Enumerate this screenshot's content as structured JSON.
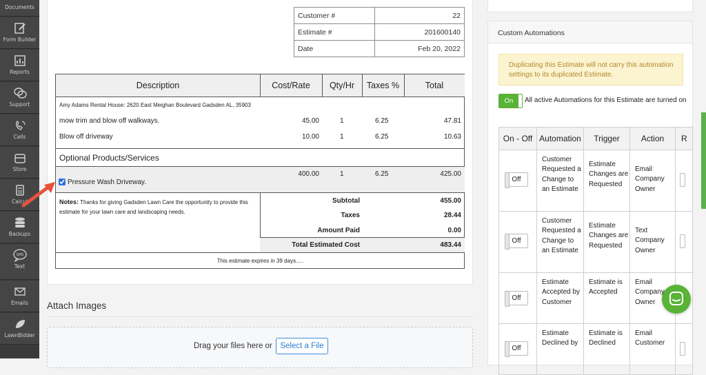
{
  "sidebar": {
    "items": [
      {
        "label": "Documents",
        "icon": "documents-icon"
      },
      {
        "label": "Form Builder",
        "icon": "form-builder-icon"
      },
      {
        "label": "Reports",
        "icon": "reports-icon"
      },
      {
        "label": "Support",
        "icon": "support-icon"
      },
      {
        "label": "Calls",
        "icon": "calls-icon"
      },
      {
        "label": "Store",
        "icon": "store-icon"
      },
      {
        "label": "Calcul",
        "icon": "calculator-icon"
      },
      {
        "label": "Backups",
        "icon": "backups-icon"
      },
      {
        "label": "Text",
        "icon": "sms-icon"
      },
      {
        "label": "Emails",
        "icon": "email-icon"
      },
      {
        "label": "LawnBidder",
        "icon": "lawnbidder-icon"
      }
    ],
    "sms_text": "SMS"
  },
  "estimate_meta": {
    "customer_label": "Customer #",
    "customer_value": "22",
    "estimate_label": "Estimate #",
    "estimate_value": "201600140",
    "date_label": "Date",
    "date_value": "Feb 20, 2022"
  },
  "estimate": {
    "headers": {
      "description": "Description",
      "cost": "Cost/Rate",
      "qty": "Qty/Hr",
      "taxes": "Taxes %",
      "total": "Total"
    },
    "address": "Amy Adams Rental House: 2620 East Meighan Boulevard Gadsden AL, 35903",
    "items": [
      {
        "description": "mow trim and blow off walkways.",
        "cost": "45.00",
        "qty": "1",
        "taxes": "6.25",
        "total": "47.81"
      },
      {
        "description": "Blow off driveway",
        "cost": "10.00",
        "qty": "1",
        "taxes": "6.25",
        "total": "10.63"
      }
    ],
    "optional_header": "Optional Products/Services",
    "optional_item": {
      "description": "Pressure Wash Driveway.",
      "cost": "400.00",
      "qty": "1",
      "taxes": "6.25",
      "total": "425.00",
      "checked": true
    },
    "notes_label": "Notes:",
    "notes_text": "Thanks for giving Gadsden Lawn Care the opportunity to provide this estimate for your lawn care and landscaping needs.",
    "subtotal_label": "Subtotal",
    "subtotal": "455.00",
    "taxes_label": "Taxes",
    "taxes": "28.44",
    "amount_paid_label": "Amount Paid",
    "amount_paid": "0.00",
    "total_label": "Total Estimated Cost",
    "total": "483.44",
    "expires": "This estimate expires in 39 days....."
  },
  "attach": {
    "title": "Attach Images",
    "drop_text": "Drag your files here or",
    "select_button": "Select a File"
  },
  "automations": {
    "title": "Custom Automations",
    "warning": "Duplicating this Estimate will not carry this automation settings to its duplicated Estimate.",
    "toggle_on": "On",
    "active_note": "All active Automations for this Estimate are turned on",
    "headers": {
      "onoff": "On - Off",
      "automation": "Automation",
      "trigger": "Trigger",
      "action": "Action",
      "r": "R"
    },
    "off_label": "Off",
    "rows": [
      {
        "automation": "Customer Requested a Change to an Estimate",
        "trigger": "Estimate Changes are Requested",
        "action": "Email Company Owner"
      },
      {
        "automation": "Customer Requested a Change to an Estimate",
        "trigger": "Estimate Changes are Requested",
        "action": "Text Company Owner"
      },
      {
        "automation": "Estimate Accepted by Customer",
        "trigger": "Estimate is Accepted",
        "action": "Email Company Owner"
      },
      {
        "automation": "Estimate Declined by",
        "trigger": "Estimate is Declined",
        "action": "Email Customer"
      }
    ]
  },
  "colors": {
    "accent_green": "#58b336",
    "link_blue": "#2b7bd1",
    "warning_bg": "#fcf3d0",
    "arrow_red": "#e5533d"
  }
}
